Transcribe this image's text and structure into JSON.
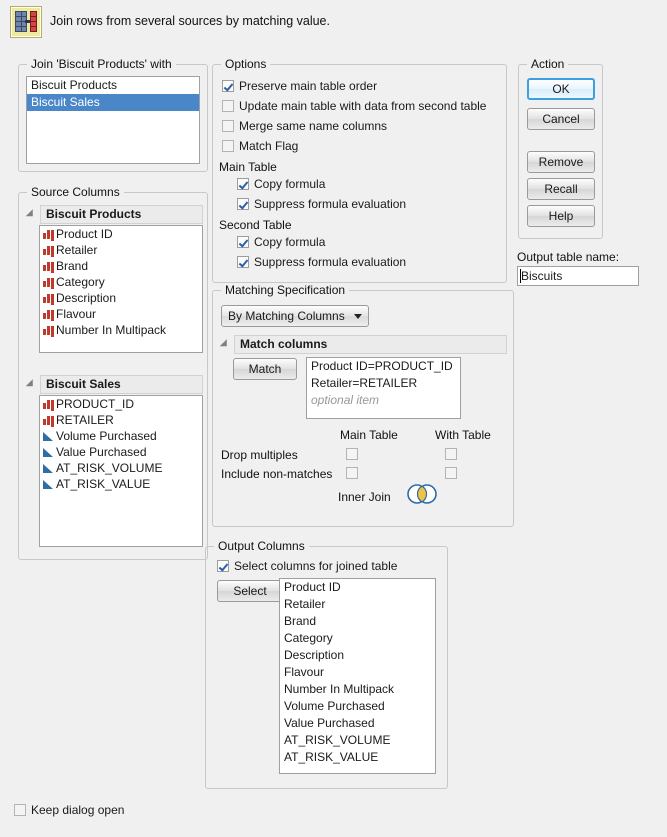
{
  "header": {
    "icon": "join-tables-icon",
    "description": "Join rows from several sources by matching value."
  },
  "join_with": {
    "legend": "Join 'Biscuit Products' with",
    "items": [
      {
        "label": "Biscuit Products",
        "selected": false
      },
      {
        "label": "Biscuit Sales",
        "selected": true
      }
    ]
  },
  "source_columns": {
    "legend": "Source Columns",
    "tables": [
      {
        "name": "Biscuit Products",
        "columns": [
          {
            "label": "Product ID",
            "type": "nominal"
          },
          {
            "label": "Retailer",
            "type": "nominal"
          },
          {
            "label": "Brand",
            "type": "nominal"
          },
          {
            "label": "Category",
            "type": "nominal"
          },
          {
            "label": "Description",
            "type": "nominal"
          },
          {
            "label": "Flavour",
            "type": "nominal"
          },
          {
            "label": "Number In Multipack",
            "type": "nominal"
          }
        ]
      },
      {
        "name": "Biscuit Sales",
        "columns": [
          {
            "label": "PRODUCT_ID",
            "type": "nominal"
          },
          {
            "label": "RETAILER",
            "type": "nominal"
          },
          {
            "label": "Volume Purchased",
            "type": "continuous"
          },
          {
            "label": "Value Purchased",
            "type": "continuous"
          },
          {
            "label": "AT_RISK_VOLUME",
            "type": "continuous"
          },
          {
            "label": "AT_RISK_VALUE",
            "type": "continuous"
          }
        ]
      }
    ]
  },
  "options": {
    "legend": "Options",
    "checkboxes": [
      {
        "label": "Preserve main table order",
        "checked": true
      },
      {
        "label": "Update main table with data from second table",
        "checked": false
      },
      {
        "label": "Merge same name columns",
        "checked": false
      },
      {
        "label": "Match Flag",
        "checked": false
      }
    ],
    "main_table_label": "Main Table",
    "main_table_checkboxes": [
      {
        "label": "Copy formula",
        "checked": true
      },
      {
        "label": "Suppress formula evaluation",
        "checked": true
      }
    ],
    "second_table_label": "Second Table",
    "second_table_checkboxes": [
      {
        "label": "Copy formula",
        "checked": true
      },
      {
        "label": "Suppress formula evaluation",
        "checked": true
      }
    ]
  },
  "action": {
    "legend": "Action",
    "buttons": [
      {
        "label": "OK",
        "default": true
      },
      {
        "label": "Cancel",
        "default": false
      },
      {
        "label": "Remove",
        "default": false
      },
      {
        "label": "Recall",
        "default": false
      },
      {
        "label": "Help",
        "default": false
      }
    ]
  },
  "output_table": {
    "label": "Output table name:",
    "value": "Biscuits"
  },
  "matching": {
    "legend": "Matching Specification",
    "mode": "By Matching Columns",
    "match_columns_title": "Match columns",
    "match_button": "Match",
    "pairs": [
      "Product ID=PRODUCT_ID",
      "Retailer=RETAILER"
    ],
    "placeholder": "optional item",
    "col_main_label": "Main Table",
    "col_with_label": "With Table",
    "rows": [
      {
        "label": "Drop multiples",
        "main_checked": false,
        "with_checked": false
      },
      {
        "label": "Include non-matches",
        "main_checked": false,
        "with_checked": false
      }
    ],
    "join_type_label": "Inner Join",
    "venn_icon": "inner-join-venn-icon",
    "venn_circle_color": "#ffffff",
    "venn_overlap_color": "#f2c14a",
    "venn_stroke_color": "#2e6ca4"
  },
  "output_columns": {
    "legend": "Output Columns",
    "select_checkbox": {
      "label": "Select columns for joined table",
      "checked": true
    },
    "select_button": "Select",
    "columns": [
      "Product ID",
      "Retailer",
      "Brand",
      "Category",
      "Description",
      "Flavour",
      "Number In Multipack",
      "Volume Purchased",
      "Value Purchased",
      "AT_RISK_VOLUME",
      "AT_RISK_VALUE"
    ]
  },
  "footer": {
    "keep_dialog_open": {
      "label": "Keep dialog open",
      "checked": false
    }
  },
  "colors": {
    "selection_blue": "#4a87c8",
    "default_button_blue": "#3c9fe0",
    "nominal_red": "#c0392b",
    "continuous_blue": "#2e6ca4",
    "background": "#f0f0f0"
  }
}
